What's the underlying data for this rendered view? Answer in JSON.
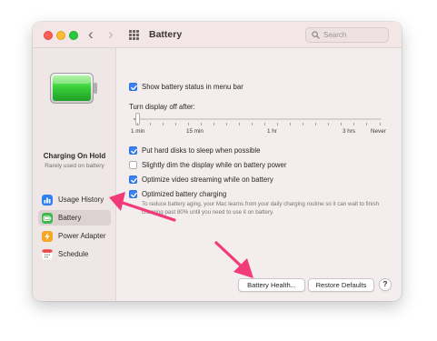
{
  "window": {
    "title": "Battery"
  },
  "toolbar": {
    "search_placeholder": "Search"
  },
  "sidebar": {
    "status_title": "Charging On Hold",
    "status_subtitle": "Rarely used on battery",
    "items": [
      {
        "label": "Usage History",
        "icon": "usage-history-icon",
        "color": "#2f7ff0"
      },
      {
        "label": "Battery",
        "icon": "battery-icon",
        "color": "#3cb94c",
        "selected": true
      },
      {
        "label": "Power Adapter",
        "icon": "power-adapter-icon",
        "color": "#f5a623"
      },
      {
        "label": "Schedule",
        "icon": "calendar-icon",
        "color": "#e84a43"
      }
    ]
  },
  "settings": {
    "show_status": {
      "label": "Show battery status in menu bar",
      "checked": true
    },
    "display_off": {
      "label": "Turn display off after:",
      "ticks": [
        "1 min",
        "15 min",
        "1 hr",
        "3 hrs",
        "Never"
      ],
      "value": "1 min"
    },
    "options": [
      {
        "label": "Put hard disks to sleep when possible",
        "checked": true
      },
      {
        "label": "Slightly dim the display while on battery power",
        "checked": false
      },
      {
        "label": "Optimize video streaming while on battery",
        "checked": true
      },
      {
        "label": "Optimized battery charging",
        "checked": true
      }
    ],
    "optimized_desc": "To reduce battery aging, your Mac learns from your daily charging routine so it can wait to finish charging past 80% until you need to use it on battery."
  },
  "buttons": {
    "battery_health": "Battery Health...",
    "restore_defaults": "Restore Defaults",
    "help": "?"
  },
  "colors": {
    "accent": "#3b82f6",
    "annotation_arrow": "#f23a79",
    "battery_fill": "#3bd13b"
  }
}
